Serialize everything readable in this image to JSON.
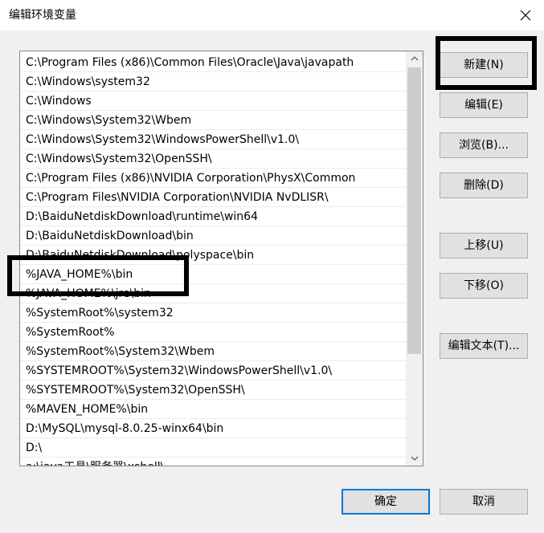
{
  "window": {
    "title": "编辑环境变量",
    "close_icon": "close-icon"
  },
  "path_list": {
    "items": [
      "C:\\Program Files (x86)\\Common Files\\Oracle\\Java\\javapath",
      "C:\\Windows\\system32",
      "C:\\Windows",
      "C:\\Windows\\System32\\Wbem",
      "C:\\Windows\\System32\\WindowsPowerShell\\v1.0\\",
      "C:\\Windows\\System32\\OpenSSH\\",
      "C:\\Program Files (x86)\\NVIDIA Corporation\\PhysX\\Common",
      "C:\\Program Files\\NVIDIA Corporation\\NVIDIA NvDLISR\\",
      "D:\\BaiduNetdiskDownload\\runtime\\win64",
      "D:\\BaiduNetdiskDownload\\bin",
      "D:\\BaiduNetdiskDownload\\polyspace\\bin",
      "%JAVA_HOME%\\bin",
      "%JAVA_HOME%\\jre\\bin",
      "%SystemRoot%\\system32",
      "%SystemRoot%",
      "%SystemRoot%\\System32\\Wbem",
      "%SYSTEMROOT%\\System32\\WindowsPowerShell\\v1.0\\",
      "%SYSTEMROOT%\\System32\\OpenSSH\\",
      "%MAVEN_HOME%\\bin",
      "D:\\MySQL\\mysql-8.0.25-winx64\\bin",
      "D:\\",
      "a:\\java工具\\服务器\\xshell\\"
    ]
  },
  "buttons": {
    "new": "新建(N)",
    "edit": "编辑(E)",
    "browse": "浏览(B)...",
    "delete": "删除(D)",
    "move_up": "上移(U)",
    "move_down": "下移(O)",
    "edit_text": "编辑文本(T)...",
    "ok": "确定",
    "cancel": "取消"
  },
  "colors": {
    "window_bg": "#f0f0f0",
    "accent": "#0078d7",
    "annotation": "#000000"
  }
}
